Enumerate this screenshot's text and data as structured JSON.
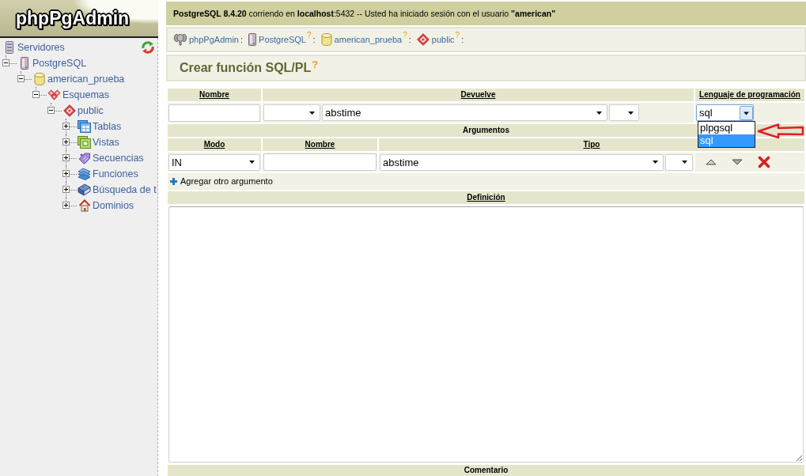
{
  "sidebar": {
    "logo": "phpPgAdmin",
    "tree": [
      {
        "kind": "servers",
        "label": "Servidores",
        "children": [
          {
            "kind": "server",
            "label": "PostgreSQL",
            "expanded": true,
            "children": [
              {
                "kind": "database",
                "label": "american_prueba",
                "expanded": true,
                "children": [
                  {
                    "kind": "schemas",
                    "label": "Esquemas",
                    "expanded": true,
                    "children": [
                      {
                        "kind": "schema",
                        "label": "public",
                        "expanded": true,
                        "children": [
                          {
                            "kind": "tables",
                            "label": "Tablas",
                            "expanded": false
                          },
                          {
                            "kind": "views",
                            "label": "Vistas",
                            "expanded": false
                          },
                          {
                            "kind": "sequences",
                            "label": "Secuencias",
                            "expanded": false
                          },
                          {
                            "kind": "functions",
                            "label": "Funciones",
                            "expanded": false
                          },
                          {
                            "kind": "fulltext",
                            "label": "Búsqueda de t",
                            "expanded": false
                          },
                          {
                            "kind": "domains",
                            "label": "Dominios",
                            "expanded": false
                          }
                        ]
                      }
                    ]
                  }
                ]
              }
            ]
          }
        ]
      }
    ]
  },
  "server_info": "**PostgreSQL 8.4.20** corriendo en **localhost**:5432 -- Usted ha iniciado sesión con el usuario **\"american\"**",
  "breadcrumb": [
    {
      "kind": "app",
      "label": "phpPgAdmin",
      "separator": ":"
    },
    {
      "kind": "server",
      "label": "PostgreSQL",
      "help": "?",
      "separator": ":"
    },
    {
      "kind": "database",
      "label": "american_prueba",
      "help": "?",
      "separator": ":"
    },
    {
      "kind": "schema",
      "label": "public",
      "help": "?",
      "separator": ":"
    }
  ],
  "page_title": {
    "text": "Crear función SQL/PL",
    "help": "?"
  },
  "form": {
    "columns": [
      "Nombre",
      "Devuelve",
      "Lenguaje de programación"
    ],
    "return_type": "abstime",
    "language": {
      "value": "sql",
      "expanded": true,
      "options": [
        {
          "label": "plpgsql",
          "selected": false
        },
        {
          "label": "sql",
          "selected": true
        }
      ]
    },
    "arguments": {
      "title": "Argumentos",
      "columns": [
        "Modo",
        "Nombre",
        "Tipo"
      ],
      "rows": [
        {
          "mode": "IN",
          "type": "abstime"
        }
      ],
      "add_label": "Agregar otro argumento"
    },
    "definition": {
      "title": "Definición"
    },
    "comment": {
      "title": "Comentario"
    }
  }
}
